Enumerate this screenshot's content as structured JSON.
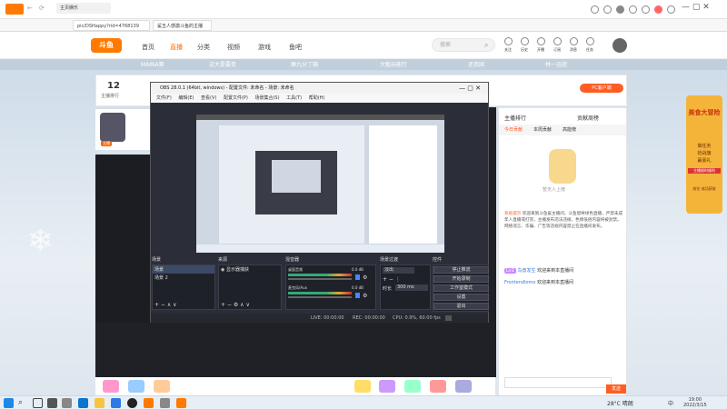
{
  "browser": {
    "tabs": [
      {
        "label": "主页娱乐"
      },
      {
        "label": "全网专享"
      }
    ],
    "url": "pic/DSHappy?rid=4768139",
    "active_tab": "鲨五人感激斗鱼的主播",
    "badges": {
      "msg": "10"
    }
  },
  "site": {
    "logo": "斗鱼",
    "nav": [
      "首页",
      "直播",
      "分类",
      "视频",
      "游戏",
      "鱼吧"
    ],
    "search_placeholder": "搜索",
    "header_icons": [
      "关注",
      "历史",
      "开播",
      "订阅",
      "消息",
      "任务"
    ]
  },
  "room": {
    "subtabs": [
      "MAINA第",
      "这大是要变",
      "雁九分丁箱",
      "大魁玩能打",
      "还我国",
      "林一迅胆"
    ],
    "stats": [
      {
        "value": "12",
        "label": "主播排行"
      }
    ],
    "streamer_badge": "主播",
    "pc_button": "PC客户端",
    "gift_count": "0",
    "follow_label": "关注"
  },
  "obs": {
    "title": "OBS 28.0.1 (64bit, windows) - 配置文件: 未命名 - 场景: 未命名",
    "menu": [
      "文件(F)",
      "编辑(E)",
      "查看(V)",
      "配置文件(P)",
      "场景集合(S)",
      "工具(T)",
      "帮助(H)"
    ],
    "docks": {
      "scenes": {
        "title": "场景",
        "items": [
          "场景",
          "场景 2"
        ]
      },
      "sources": {
        "title": "来源",
        "items": [
          "显示器捕获"
        ]
      },
      "mixer": {
        "title": "混音器",
        "channels": [
          {
            "name": "桌面音频",
            "db": "0.0 dB"
          },
          {
            "name": "麦克风/Aux",
            "db": "0.0 dB"
          }
        ]
      },
      "transitions": {
        "title": "场景过渡",
        "type": "淡出",
        "duration_label": "时长",
        "duration": "300 ms"
      },
      "controls": {
        "title": "控件",
        "buttons": [
          "停止推流",
          "开始录制",
          "工作室模式",
          "设置",
          "退出"
        ]
      }
    },
    "status": {
      "live": "LIVE: 00:00:00",
      "rec": "REC: 00:00:00",
      "cpu": "CPU: 0.9%, 60.00 fps"
    }
  },
  "chat": {
    "title": "主播排行",
    "right_title": "贡献周榜",
    "tabs": [
      "今日贡献",
      "本周贡献",
      "高能榜"
    ],
    "empty_text": "暂无人上榜",
    "notice_label": "系统提示",
    "notice": "欢迎来到斗鱼鲨主播间，斗鱼倡导绿色直播，严禁未成年人直播或打赏，主播发布违法违规、色情低俗内容将被封禁。网络谣言、诈骗、广告等违规内容禁止在直播间发布。",
    "messages": [
      {
        "user": "鸟兽发生",
        "text": "欢迎来到本直播间"
      },
      {
        "user": "Frontendlomo",
        "text": "欢迎来到本直播间"
      }
    ],
    "send_label": "发送",
    "level_badge": "Lv1"
  },
  "promo": {
    "title": "美食大冒险",
    "lines": [
      "做任务",
      "抢战旗",
      "赢豪礼"
    ],
    "sub": "主播限时福利",
    "foot": "前往 成功获取"
  },
  "taskbar": {
    "weather": "28°C 晴朗",
    "time": "19:00",
    "date": "2022/3/15",
    "lang": "中"
  },
  "colors": {
    "brand": "#ff6b00",
    "obs_bg": "#2b2e38",
    "chat_accent": "#ff5d23"
  }
}
